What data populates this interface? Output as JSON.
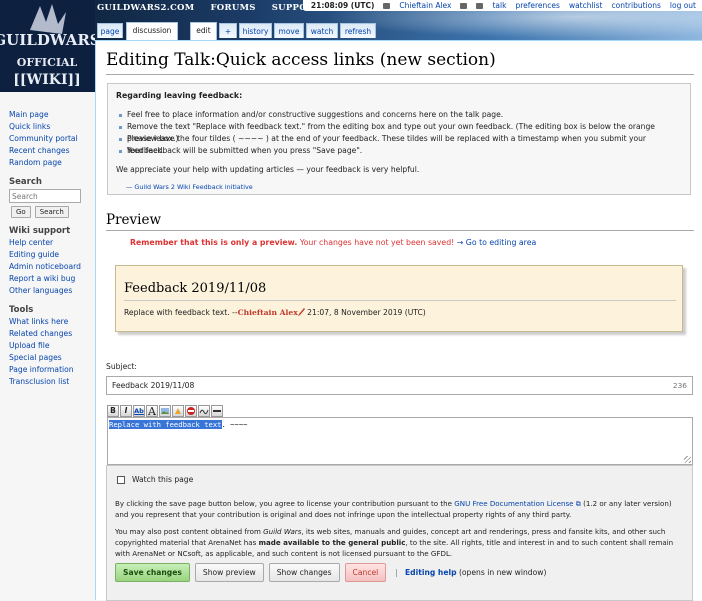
{
  "site_nav": [
    "GUILDWARS2.COM",
    "FORUMS",
    "SUPPORT"
  ],
  "logo": {
    "line1": "GUILDWARS",
    "line2": "OFFICIAL",
    "line3": "[[WIKI]]"
  },
  "personal": {
    "clock": "21:08:09 (UTC)",
    "user": "Chieftain Alex",
    "links": [
      "talk",
      "preferences",
      "watchlist",
      "contributions",
      "log out"
    ]
  },
  "tabs": {
    "page": "page",
    "discussion": "discussion",
    "edit": "edit",
    "plus": "+",
    "history": "history",
    "move": "move",
    "watch": "watch",
    "refresh": "refresh"
  },
  "sidebar": {
    "nav": [
      "Main page",
      "Quick links",
      "Community portal",
      "Recent changes",
      "Random page"
    ],
    "search": {
      "heading": "Search",
      "placeholder": "Search",
      "go": "Go",
      "search": "Search"
    },
    "wiki_support": {
      "heading": "Wiki support",
      "items": [
        "Help center",
        "Editing guide",
        "Admin noticeboard",
        "Report a wiki bug",
        "Other languages"
      ]
    },
    "tools": {
      "heading": "Tools",
      "items": [
        "What links here",
        "Related changes",
        "Upload file",
        "Special pages",
        "Page information",
        "Transclusion list"
      ]
    }
  },
  "page_title": "Editing Talk:Quick access links (new section)",
  "notice": {
    "heading": "Regarding leaving feedback:",
    "items": [
      "Feel free to place information and/or constructive suggestions and concerns here on the talk page.",
      "Remove the text \"Replace with feedback text.\" from the editing box and type out your own feedback. (The editing box is below the orange preview box.)",
      "Please leave the four tildes ( ~~~~ ) at the end of your feedback. These tildes will be replaced with a timestamp when you submit your feedback.",
      "Your feedback will be submitted when you press \"Save page\"."
    ],
    "paragraph": "We appreciate your help with updating articles — your feedback is very helpful.",
    "signature": "— Guild Wars 2 Wiki Feedback initiative"
  },
  "preview": {
    "heading": "Preview",
    "warning_strong": "Remember that this is only a preview.",
    "warning_rest": " Your changes have not yet been saved!",
    "warning_link": "→ Go to editing area",
    "box_heading": "Feedback 2019/11/08",
    "box_text": "Replace with feedback text. --",
    "box_signame": "Chieftain Alex",
    "box_time": " 21:07, 8 November 2019 (UTC)"
  },
  "subject": {
    "label": "Subject:",
    "value": "Feedback 2019/11/08",
    "counter": "236"
  },
  "toolbar": {
    "icons": [
      "bold-icon",
      "italic-icon",
      "link-icon",
      "heading-icon",
      "image-icon",
      "media-icon",
      "nowiki-icon",
      "signature-icon",
      "hr-icon"
    ],
    "bold": "B",
    "italic": "I",
    "ab": "Ab",
    "big_a": "A"
  },
  "editor": {
    "selected": "Replace with feedback text",
    "rest": ". ~~~~"
  },
  "options": {
    "watch_label": "Watch this page",
    "license1_a": "By clicking the save page button below, you agree to license your contribution pursuant to the ",
    "license1_link": "GNU Free Documentation License",
    "license1_b": " (1.2 or any later version) and you represent that your contribution is original and does not infringe upon the intellectual property rights of any third party.",
    "license2_a": "You may also post content obtained from ",
    "license2_italic": "Guild Wars",
    "license2_b": ", its web sites, manuals and guides, concept art and renderings, press and fansite kits, and other such copyrighted material that ArenaNet has ",
    "license2_bold": "made available to the general public",
    "license2_c": ", to the site. All rights, title and interest in and to such content shall remain with ArenaNet or NCsoft, as applicable, and such content is not licensed pursuant to the GFDL.",
    "save": "Save changes",
    "show_preview": "Show preview",
    "show_changes": "Show changes",
    "cancel": "Cancel",
    "separator": "|",
    "help": "Editing help",
    "help_tail": " (opens in new window)"
  },
  "colors": {
    "link": "#0645ad",
    "warning": "#dd3333",
    "preview_bg": "#fdf3dc",
    "save_green": "#9ad47f"
  }
}
